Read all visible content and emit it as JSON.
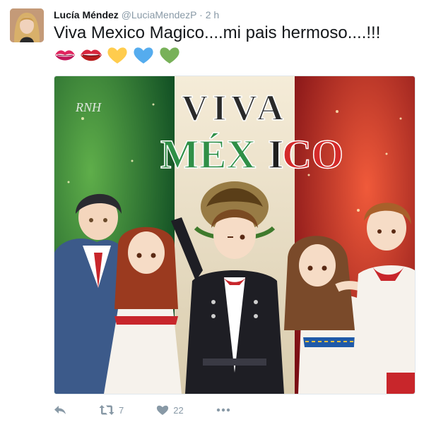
{
  "tweet": {
    "name": "Lucía Méndez",
    "handle": "@LuciaMendezP",
    "separator": "·",
    "time": "2 h",
    "text": "Viva  Mexico Magico....mi pais hermoso....!!!",
    "emojis": [
      "kiss-mark-icon",
      "lips-icon",
      "yellow-heart-icon",
      "blue-heart-icon",
      "green-heart-icon"
    ],
    "media": {
      "title_line1": "VIVA",
      "title_line2_green": "MÉX",
      "title_line2_black": "I",
      "title_line2_red": "CO",
      "signature": "RNH",
      "colors": {
        "green": "#1f7a3a",
        "white": "#f2ead8",
        "red": "#c8262b"
      }
    },
    "actions": {
      "reply_icon": "reply-icon",
      "retweet_icon": "retweet-icon",
      "retweet_count": "7",
      "like_icon": "heart-icon",
      "like_count": "22",
      "more_icon": "more-icon"
    }
  }
}
